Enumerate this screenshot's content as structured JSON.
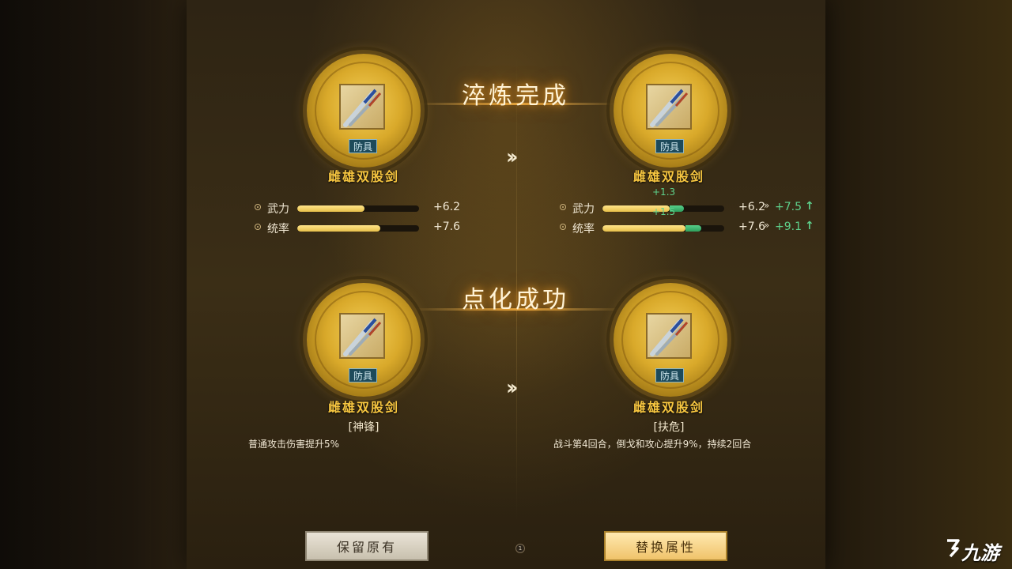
{
  "refine": {
    "title": "淬炼完成",
    "before": {
      "item_tag": "防具",
      "item_name": "雌雄双股剑",
      "stats": [
        {
          "label": "武力",
          "value": "+6.2",
          "fill_fraction": 0.55
        },
        {
          "label": "统率",
          "value": "+7.6",
          "fill_fraction": 0.68
        }
      ]
    },
    "after": {
      "item_tag": "防具",
      "item_name": "雌雄双股剑",
      "stats": [
        {
          "label": "武力",
          "value": "+6.2",
          "delta": "+1.3",
          "new_value": "+7.5",
          "fill_fraction": 0.55,
          "gain_fraction": 0.12
        },
        {
          "label": "统率",
          "value": "+7.6",
          "delta": "+1.5",
          "new_value": "+9.1",
          "fill_fraction": 0.68,
          "gain_fraction": 0.13
        }
      ]
    }
  },
  "enlighten": {
    "title": "点化成功",
    "before": {
      "item_tag": "防具",
      "item_name": "雌雄双股剑",
      "effect_name": "[神锋]",
      "effect_desc": "普通攻击伤害提升5%"
    },
    "after": {
      "item_tag": "防具",
      "item_name": "雌雄双股剑",
      "effect_name": "[扶危]",
      "effect_desc": "战斗第4回合，倒戈和攻心提升9%，持续2回合"
    }
  },
  "buttons": {
    "keep": "保留原有",
    "replace": "替换属性"
  },
  "page_indicator": "1",
  "watermark": {
    "text": "九游",
    "icon": "jiuyou-logo-icon"
  },
  "colors": {
    "accent_gold": "#f7c640",
    "gain_green": "#5ed18c"
  }
}
